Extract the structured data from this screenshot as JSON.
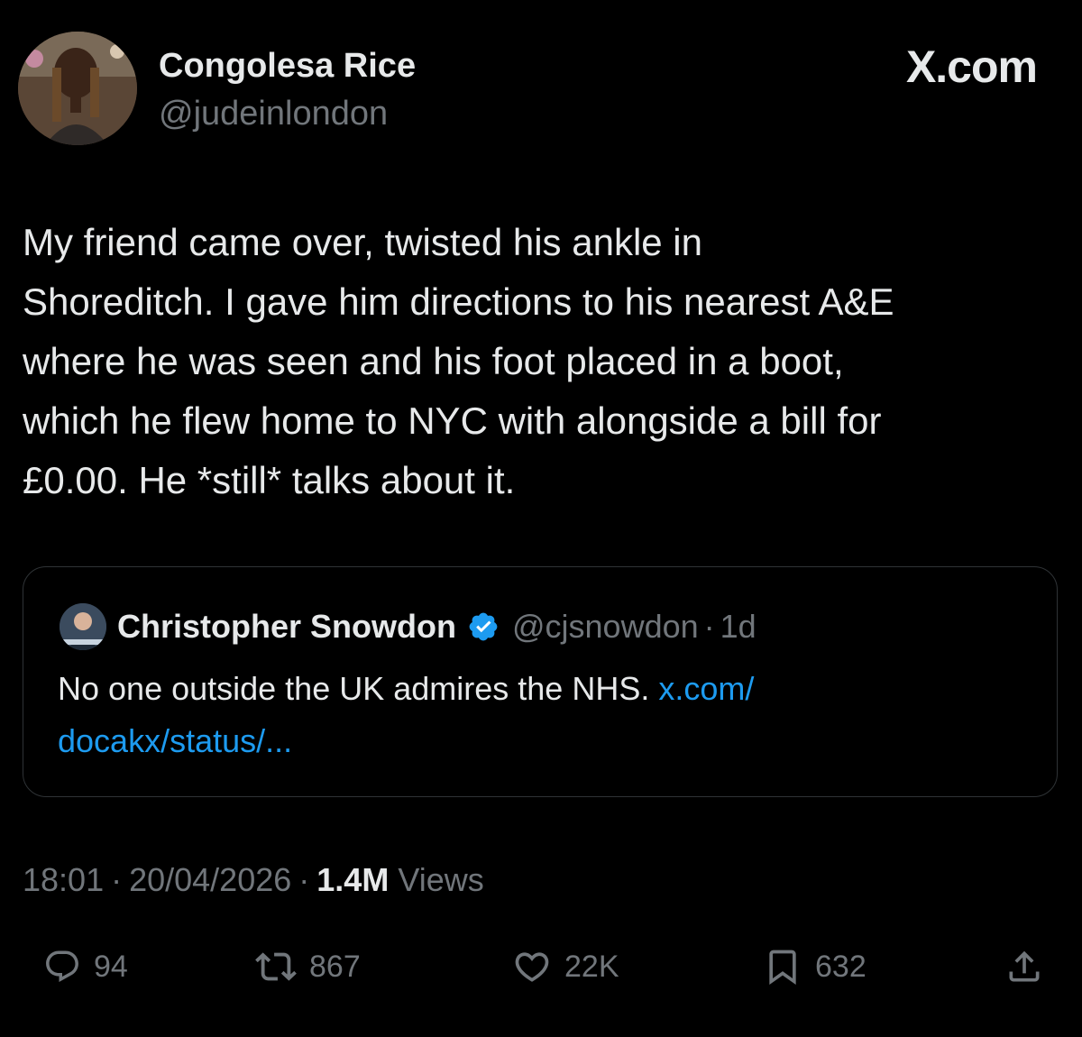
{
  "author": {
    "name": "Congolesa Rice",
    "handle": "@judeinlondon"
  },
  "brand": "X.com",
  "tweet": {
    "text": "My friend came over, twisted his ankle in\nShoreditch. I gave him directions to his nearest A&E\nwhere he was seen and his foot placed in a boot,\nwhich he flew home to NYC with alongside a bill for\n£0.00. He *still* talks about it."
  },
  "quote": {
    "name": "Christopher Snowdon",
    "handle": "@cjsnowdon",
    "separator": "·",
    "time": "1d",
    "text": "No one outside the UK admires the NHS. ",
    "link_line1": "x.com/",
    "link_line2": "docakx/status/..."
  },
  "meta": {
    "time": "18:01",
    "date": "20/04/2026",
    "separator": "·",
    "views_count": "1.4M",
    "views_label": "Views"
  },
  "actions": {
    "replies": "94",
    "reposts": "867",
    "likes": "22K",
    "bookmarks": "632"
  },
  "colors": {
    "background": "#000000",
    "text_primary": "#e7e9ea",
    "text_secondary": "#71767b",
    "link": "#1d9bf0",
    "border": "#2f3336",
    "verified": "#1d9bf0"
  },
  "icons": [
    "reply-icon",
    "repost-icon",
    "like-icon",
    "bookmark-icon",
    "share-icon",
    "verified-badge-icon"
  ]
}
